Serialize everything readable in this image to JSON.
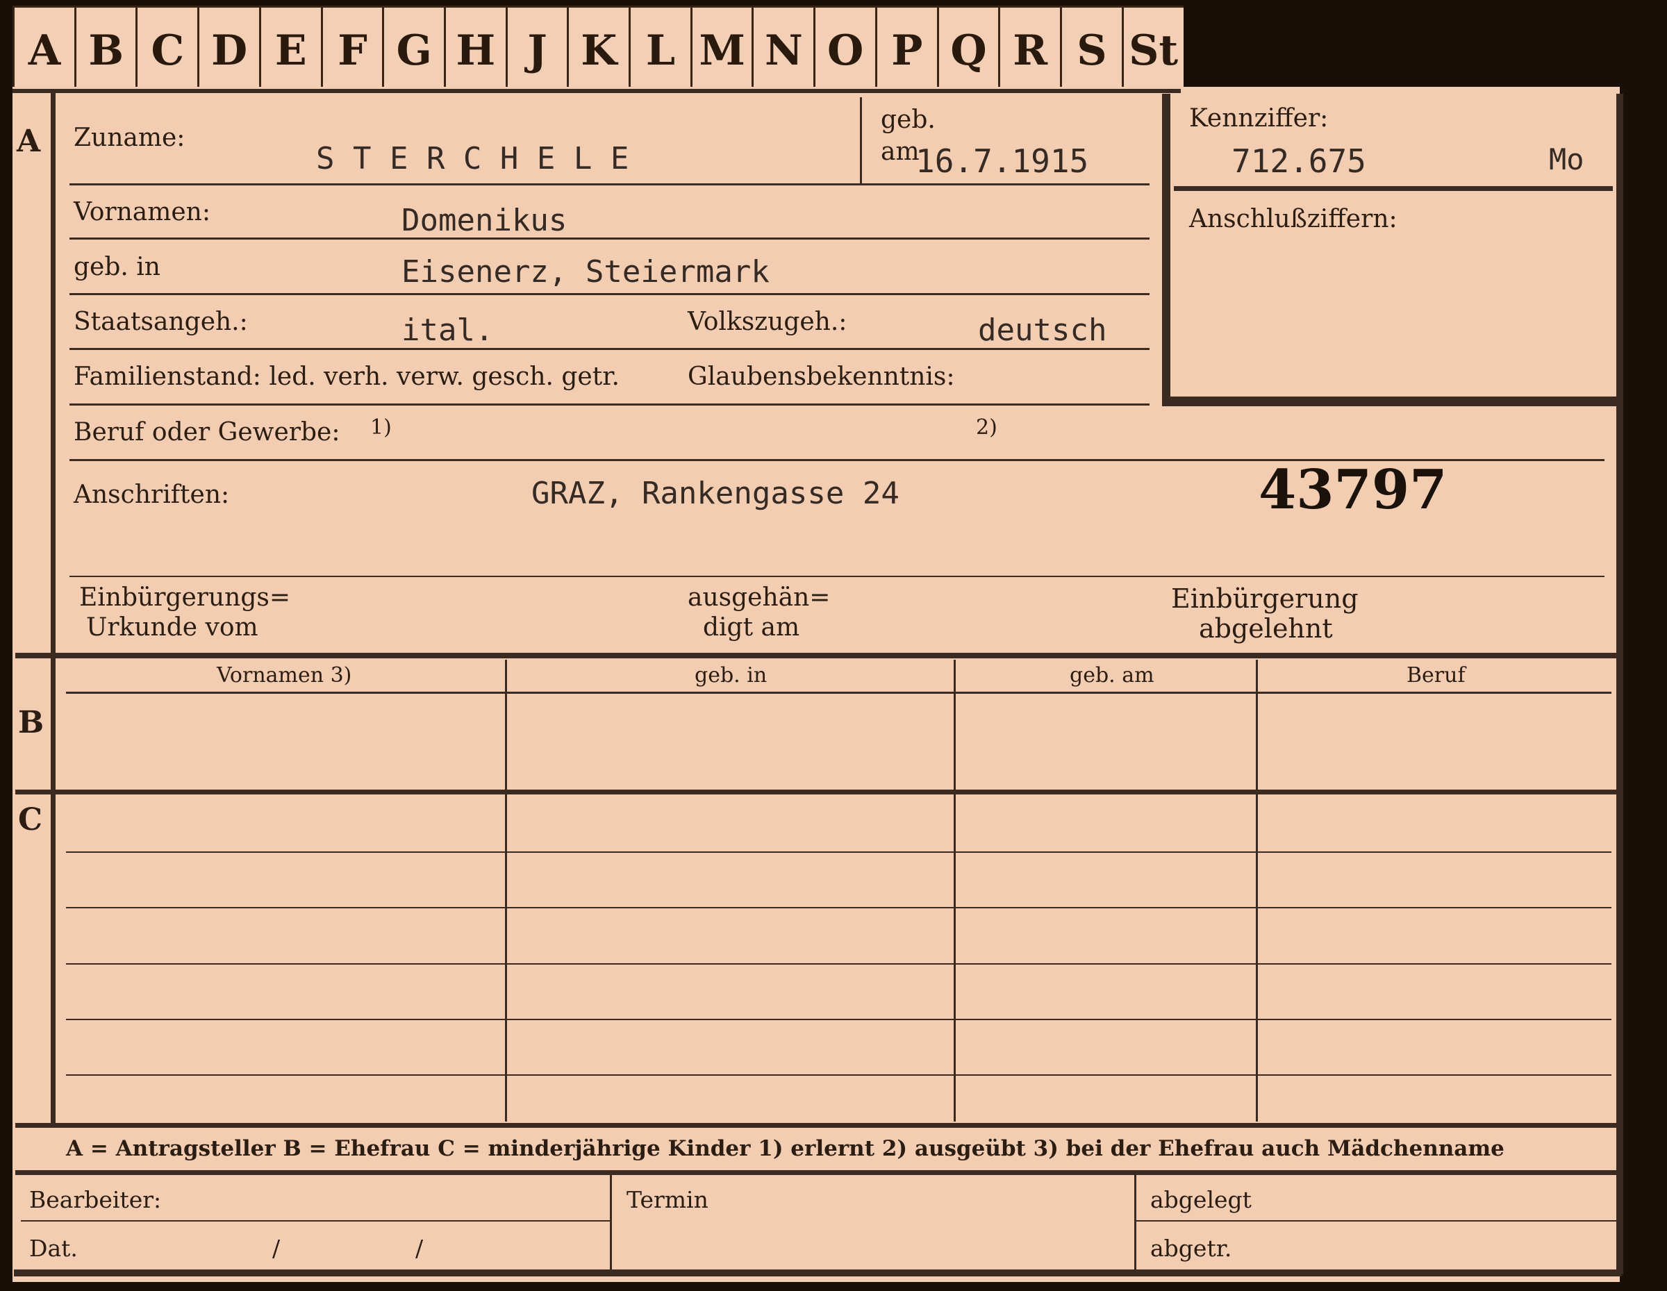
{
  "tabs": [
    "A",
    "B",
    "C",
    "D",
    "E",
    "F",
    "G",
    "H",
    "J",
    "K",
    "L",
    "M",
    "N",
    "O",
    "P",
    "Q",
    "R",
    "S",
    "St"
  ],
  "section_letters": {
    "a": "A",
    "b": "B",
    "c": "C"
  },
  "labels": {
    "zuname": "Zuname:",
    "geb_am_top": "geb.",
    "geb_am_bottom": "am",
    "kennziffer": "Kennziffer:",
    "anschlussziffern": "Anschlußziffern:",
    "vornamen": "Vornamen:",
    "geb_in": "geb. in",
    "staatsangeh": "Staatsangeh.:",
    "volkszugeh": "Volkszugeh.:",
    "familienstand": "Familienstand: led. verh. verw. gesch. getr.",
    "glaubensbekenntnis": "Glaubensbekenntnis:",
    "beruf": "Beruf oder Gewerbe:",
    "beruf_fn1": "1)",
    "beruf_fn2": "2)",
    "anschriften": "Anschriften:",
    "einbuergerungs_1": "Einbürgerungs=",
    "einbuergerungs_2": "Urkunde vom",
    "ausgehaendigt_1": "ausgehän=",
    "ausgehaendigt_2": "digt am",
    "abgelehnt_1": "Einbürgerung",
    "abgelehnt_2": "abgelehnt"
  },
  "values": {
    "surname": "S T E R C H E L E",
    "birth_date": "16.7.1915",
    "kennziffer": "712.675",
    "kennziffer_suffix": "Mo",
    "first_names": "Domenikus",
    "birthplace": "Eisenerz, Steiermark",
    "citizenship": "ital.",
    "ethnicity": "deutsch",
    "address": "GRAZ, Rankengasse 24",
    "number": "43797"
  },
  "table": {
    "headers": [
      "Vornamen 3)",
      "geb. in",
      "geb. am",
      "Beruf"
    ]
  },
  "legend": "A = Antragsteller   B = Ehefrau   C = minderjährige Kinder   1) erlernt   2) ausgeübt   3) bei der Ehefrau auch Mädchenname",
  "footer": {
    "bearbeiter": "Bearbeiter:",
    "dat": "Dat.",
    "slash1": "/",
    "slash2": "/",
    "termin": "Termin",
    "abgelegt": "abgelegt",
    "abgetr": "abgetr."
  }
}
